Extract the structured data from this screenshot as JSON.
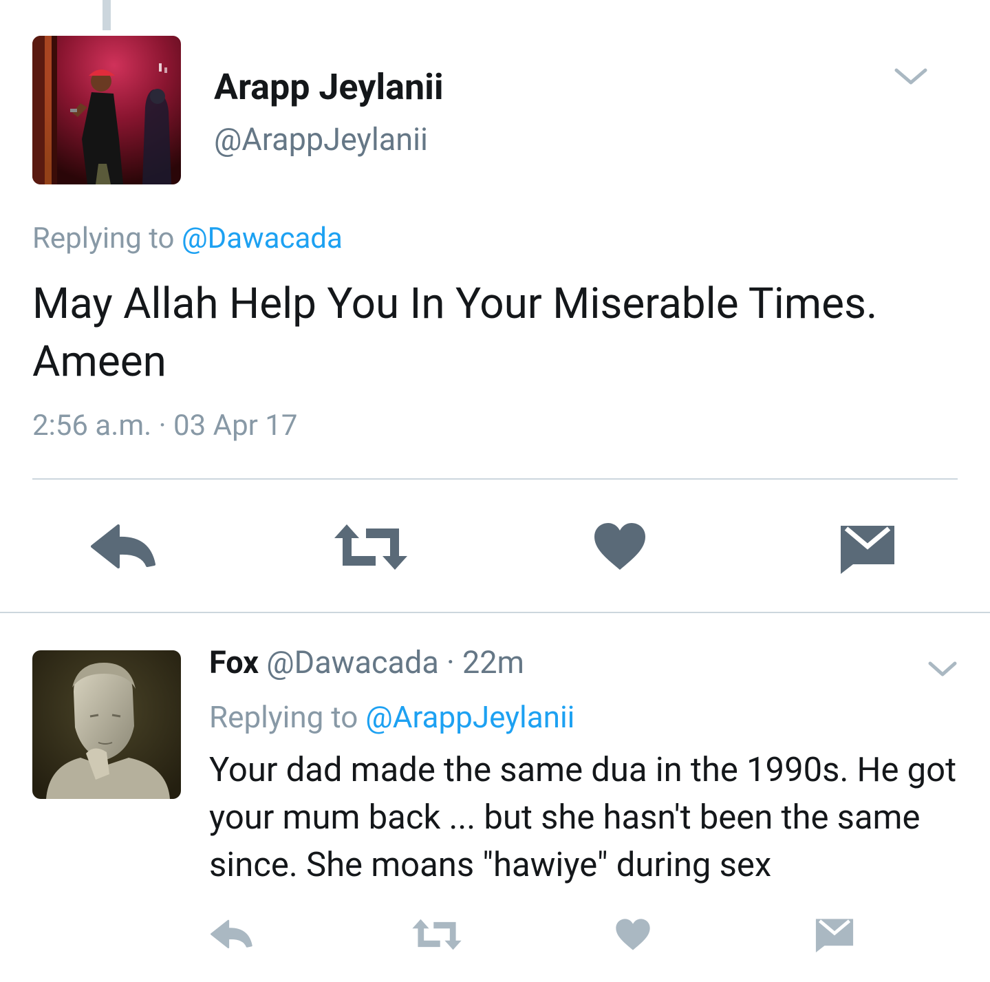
{
  "main_tweet": {
    "display_name": "Arapp Jeylanii",
    "handle": "@ArappJeylanii",
    "replying_prefix": "Replying to",
    "replying_to": "@Dawacada",
    "text": "May Allah Help You In Your Miserable Times. Ameen",
    "timestamp": "2:56 a.m. · 03 Apr 17",
    "actions": [
      {
        "name": "reply",
        "icon": "reply-icon"
      },
      {
        "name": "retweet",
        "icon": "retweet-icon"
      },
      {
        "name": "like",
        "icon": "heart-icon"
      },
      {
        "name": "message",
        "icon": "envelope-icon"
      }
    ]
  },
  "reply_tweet": {
    "display_name": "Fox",
    "handle": "@Dawacada",
    "time_ago": " · 22m",
    "replying_prefix": "Replying to",
    "replying_to": "@ArappJeylanii",
    "text": "Your dad made the same dua in the 1990s. He got your mum back ... but she hasn't been the same since.  She moans \"hawiye\" during sex",
    "actions": [
      {
        "name": "reply",
        "icon": "reply-icon"
      },
      {
        "name": "retweet",
        "icon": "retweet-icon"
      },
      {
        "name": "like",
        "icon": "heart-icon"
      },
      {
        "name": "message",
        "icon": "envelope-icon"
      }
    ]
  },
  "colors": {
    "link": "#1da1f2",
    "secondary_text": "#8899a6",
    "handle_text": "#657786",
    "main_action_icon": "#5a6a78",
    "reply_action_icon": "#aab8c2",
    "divider": "#ccd6dd"
  }
}
